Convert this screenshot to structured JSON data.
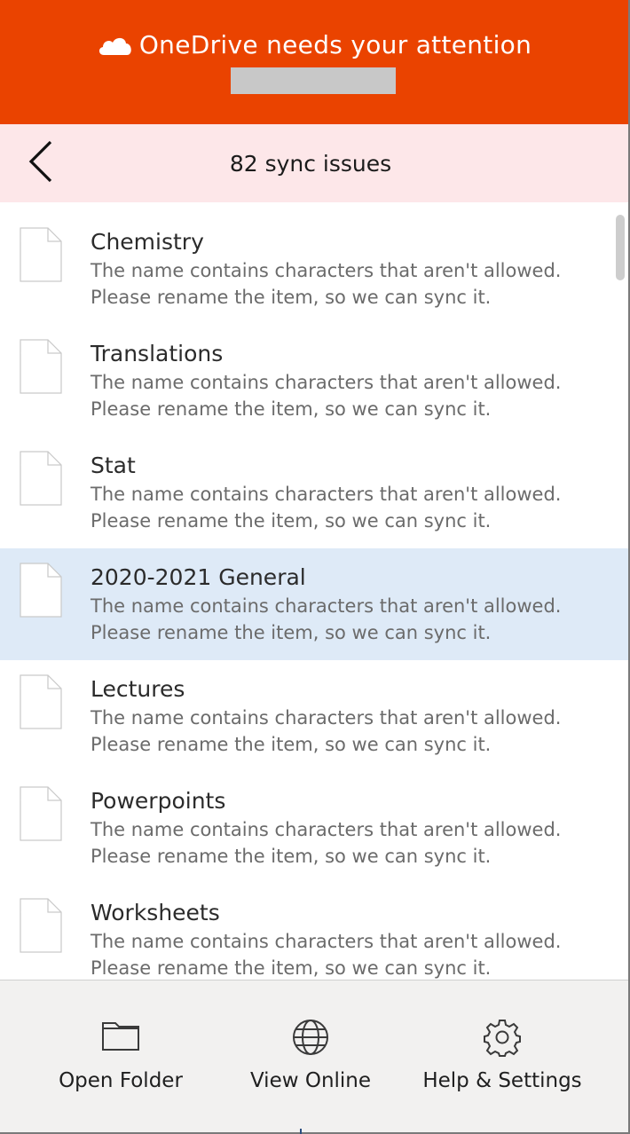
{
  "header": {
    "title": "OneDrive needs your attention",
    "icon": "cloud-icon",
    "background": "#ea4300"
  },
  "subheader": {
    "title": "82 sync issues",
    "back_icon": "chevron-left-icon",
    "background": "#fde7e9"
  },
  "issues": [
    {
      "name": "Chemistry",
      "line1": "The name contains characters that aren't allowed.",
      "line2": "Please rename the item, so we can sync it."
    },
    {
      "name": "Translations",
      "line1": "The name contains characters that aren't allowed.",
      "line2": "Please rename the item, so we can sync it."
    },
    {
      "name": "Stat",
      "line1": "The name contains characters that aren't allowed.",
      "line2": "Please rename the item, so we can sync it."
    },
    {
      "name": "2020-2021 General",
      "line1": "The name contains characters that aren't allowed.",
      "line2": "Please rename the item, so we can sync it.",
      "selected": true
    },
    {
      "name": "Lectures",
      "line1": "The name contains characters that aren't allowed.",
      "line2": "Please rename the item, so we can sync it."
    },
    {
      "name": "Powerpoints",
      "line1": "The name contains characters that aren't allowed.",
      "line2": "Please rename the item, so we can sync it."
    },
    {
      "name": "Worksheets",
      "line1": "The name contains characters that aren't allowed.",
      "line2": "Please rename the item, so we can sync it."
    }
  ],
  "footer": {
    "open_folder": {
      "label": "Open Folder",
      "icon": "folder-icon"
    },
    "view_online": {
      "label": "View Online",
      "icon": "globe-icon"
    },
    "help_settings": {
      "label": "Help & Settings",
      "icon": "gear-icon"
    }
  },
  "colors": {
    "selected_row": "#deeaf7",
    "footer_bg": "#f2f1f0"
  }
}
